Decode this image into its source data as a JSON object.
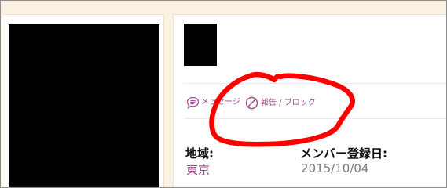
{
  "profile": {
    "actions": {
      "message_label": "メッセージ",
      "report_label": "報告 / ブロック",
      "message_icon": "chat-bubble-icon",
      "report_icon": "prohibited-icon"
    },
    "fields": [
      {
        "label": "地域:",
        "value": "東京"
      },
      {
        "label": "メンバー登録日:",
        "value": "2015/10/04"
      }
    ]
  },
  "colors": {
    "accent": "#a04a8e",
    "annotation": "#ff0000",
    "background": "#fbf2e4",
    "muted_text": "#7c7c7c"
  }
}
